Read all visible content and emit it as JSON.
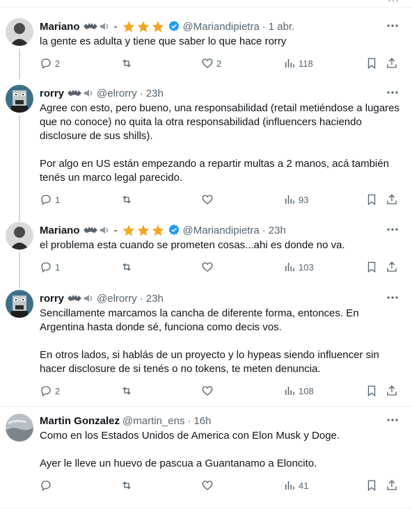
{
  "tweets": [
    {
      "name": "Mariano",
      "handle": "@Mariandipietra",
      "time": "1 abr.",
      "has_stars": true,
      "verified": true,
      "text": "la gente es adulta y tiene que saber lo que hace rorry",
      "replies": "2",
      "reposts": "",
      "likes": "2",
      "views": "118"
    },
    {
      "name": "rorry",
      "handle": "@elrorry",
      "time": "23h",
      "has_stars": false,
      "verified": false,
      "text": "Agree con esto, pero bueno, una responsabilidad (retail metiéndose a lugares que no conoce) no quita la otra responsabilidad (influencers haciendo disclosure de sus shills).\n\nPor algo en US están empezando a repartir multas a 2 manos, acá también tenés un marco legal parecido.",
      "replies": "1",
      "reposts": "",
      "likes": "",
      "views": "93"
    },
    {
      "name": "Mariano",
      "handle": "@Mariandipietra",
      "time": "23h",
      "has_stars": true,
      "verified": true,
      "text": "el problema esta cuando se prometen cosas...ahi es donde no va.",
      "replies": "1",
      "reposts": "",
      "likes": "",
      "views": "103"
    },
    {
      "name": "rorry",
      "handle": "@elrorry",
      "time": "23h",
      "has_stars": false,
      "verified": false,
      "text": "Sencillamente marcamos la cancha de diferente forma, entonces. En Argentina hasta donde sé, funciona como decis vos.\n\nEn otros lados, si hablás de un proyecto y lo hypeas siendo influencer sin hacer disclosure de si tenés o no tokens, te meten denuncia.",
      "replies": "2",
      "reposts": "",
      "likes": "",
      "views": "108"
    },
    {
      "name": "Martin Gonzalez",
      "handle": "@martin_ens",
      "time": "16h",
      "has_stars": false,
      "verified": false,
      "text": "Como en los Estados Unidos de America con Elon Musk y Doge.\n\nAyer le lleve un huevo de pascua a Guantanamo a Eloncito.",
      "replies": "",
      "reposts": "",
      "likes": "",
      "views": "41"
    }
  ],
  "colors": {
    "text": "#0f1419",
    "secondary": "#536471",
    "star": "#f4a621",
    "verified": "#1d9bf0",
    "thread_line": "#cfd9de"
  },
  "separator": "·"
}
